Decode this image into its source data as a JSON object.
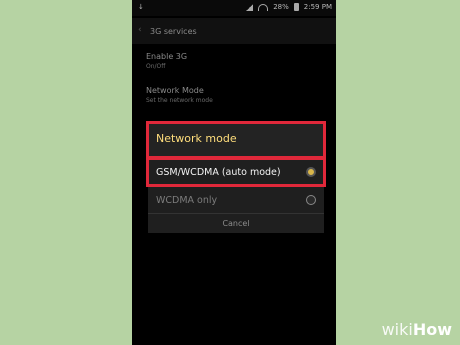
{
  "statusbar": {
    "left": "↓",
    "battery": "28%",
    "time": "2:59 PM"
  },
  "actionbar": {
    "title": "3G services"
  },
  "settings": [
    {
      "title": "Enable 3G",
      "subtitle": "On/Off"
    },
    {
      "title": "Network Mode",
      "subtitle": "Set the network mode"
    }
  ],
  "dialog": {
    "title": "Network mode",
    "options": [
      {
        "label": "GSM/WCDMA (auto mode)",
        "selected": true
      },
      {
        "label": "WCDMA only",
        "selected": false
      }
    ],
    "cancel": "Cancel"
  },
  "watermark": {
    "prefix": "wiki",
    "suffix": "How"
  },
  "colors": {
    "background": "#b6d3a3",
    "highlight": "#e0283a",
    "accent": "#ffde7c",
    "radio_selected": "#d9b64a"
  }
}
